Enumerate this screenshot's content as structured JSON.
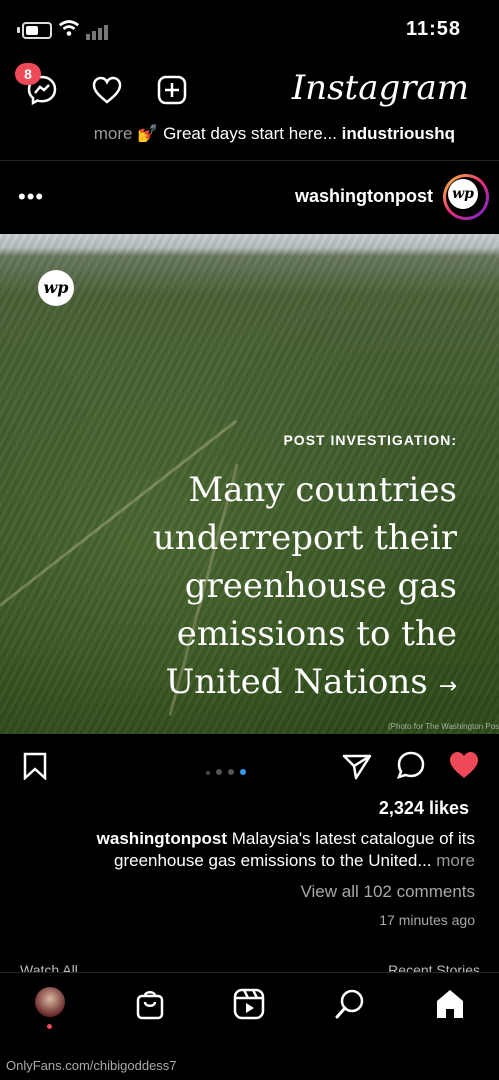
{
  "status": {
    "time": "11:58"
  },
  "app": {
    "title": "Instagram",
    "notification_count": "8"
  },
  "previous_post": {
    "user": "industrioushq",
    "text": "💅 Great days start here...",
    "more": "more"
  },
  "post": {
    "user": "washingtonpost",
    "avatar_text": "wp",
    "menu": "•••",
    "image": {
      "logo_text": "wp",
      "kicker": "POST INVESTIGATION:",
      "headline": "Many countries underreport their greenhouse gas emissions to the United Nations",
      "arrow": "→",
      "credit": "(Photo for The Washington Post)"
    },
    "carousel": {
      "count": 4,
      "active_index": 3
    },
    "likes": "2,324 likes",
    "caption_user": "washingtonpost",
    "caption_text": "Malaysia's latest catalogue of its greenhouse gas emissions to the United...",
    "caption_more": "more",
    "view_comments": "View all 102 comments",
    "time_ago": "17 minutes ago"
  },
  "next_section": {
    "left": "Watch All",
    "right": "Recent Stories"
  },
  "footer": "OnlyFans.com/chibigoddess7",
  "colors": {
    "accent": "#3897f0",
    "like": "#ed4956",
    "badge": "#ed4956"
  }
}
